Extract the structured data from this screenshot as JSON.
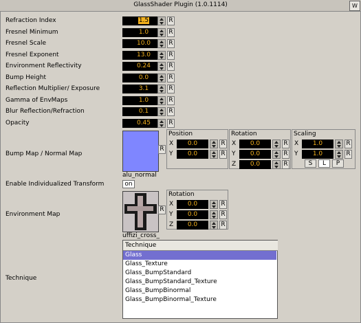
{
  "window": {
    "title": "GlassShader Plugin (1.0.1114)",
    "icon": "wizard-icon"
  },
  "params": [
    {
      "label": "Refraction Index",
      "value": "1.5",
      "selected": true
    },
    {
      "label": "Fresnel Minimum",
      "value": "1.0"
    },
    {
      "label": "Fresnel Scale",
      "value": "10.0"
    },
    {
      "label": "Fresnel Exponent",
      "value": "13.0"
    },
    {
      "label": "Environment Reflectivity",
      "value": "0.24"
    },
    {
      "label": "Bump Height",
      "value": "0.0"
    },
    {
      "label": "Reflection Multiplier/ Exposure",
      "value": "3.1"
    },
    {
      "label": "Gamma of EnvMaps",
      "value": "1.0"
    },
    {
      "label": "Blur Reflection/Refraction",
      "value": "0.1"
    },
    {
      "label": "Opacity",
      "value": "0.45"
    }
  ],
  "reset_label": "R",
  "bump": {
    "label": "Bump Map / Normal Map",
    "image_name": "alu_normal",
    "position": {
      "title": "Position",
      "x_label": "X",
      "y_label": "Y",
      "x": "0.0",
      "y": "0.0"
    },
    "rotation": {
      "title": "Rotation",
      "x_label": "X",
      "y_label": "Y",
      "z_label": "Z",
      "x": "0.0",
      "y": "0.0",
      "z": "0.0"
    },
    "scaling": {
      "title": "Scaling",
      "x_label": "X",
      "y_label": "Y",
      "x": "1.0",
      "y": "1.0",
      "buttons": [
        "S",
        "L",
        "P"
      ],
      "selected": "L"
    }
  },
  "transform": {
    "label": "Enable Individualized Transform",
    "value": "on"
  },
  "env": {
    "label": "Environment Map",
    "image_name": "uffizi_cross_",
    "rotation": {
      "title": "Rotation",
      "x_label": "X",
      "y_label": "Y",
      "z_label": "Z",
      "x": "0.0",
      "y": "0.0",
      "z": "0.0"
    }
  },
  "technique": {
    "label": "Technique",
    "header": "Technique",
    "items": [
      "Glass",
      "Glass_Texture",
      "Glass_BumpStandard",
      "Glass_BumpStandard_Texture",
      "Glass_BumpBinormal",
      "Glass_BumpBinormal_Texture"
    ],
    "selected": "Glass"
  }
}
